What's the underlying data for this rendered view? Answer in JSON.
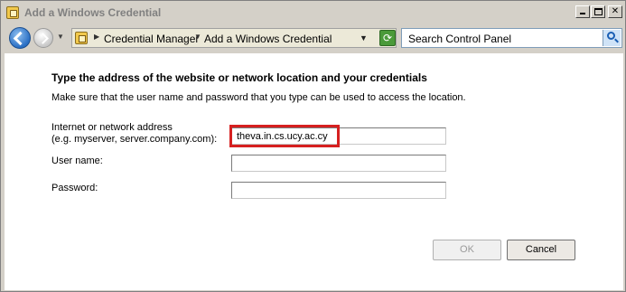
{
  "window": {
    "title": "Add a Windows Credential"
  },
  "navbar": {
    "breadcrumbs": [
      "Credential Manager",
      "Add a Windows Credential"
    ],
    "search_placeholder": "Search Control Panel"
  },
  "form": {
    "heading": "Type the address of the website or network location and your credentials",
    "subtext": "Make sure that the user name and password that you type can be used to access the location.",
    "address_label_line1": "Internet or network address",
    "address_label_line2": "(e.g. myserver, server.company.com):",
    "address_value": "theva.in.cs.ucy.ac.cy",
    "username_label": "User name:",
    "username_value": "",
    "password_label": "Password:",
    "password_value": ""
  },
  "buttons": {
    "ok_label": "OK",
    "cancel_label": "Cancel"
  },
  "colors": {
    "highlight": "#d62020",
    "window_chrome": "#d4d0c8"
  }
}
